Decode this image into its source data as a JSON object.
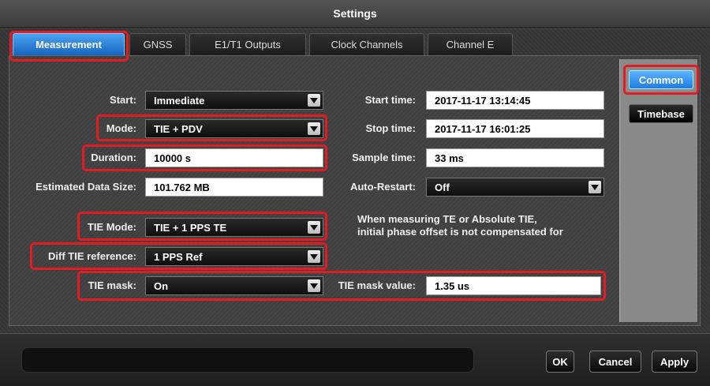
{
  "window": {
    "title": "Settings"
  },
  "tabs": [
    "Measurement",
    "GNSS",
    "E1/T1 Outputs",
    "Clock Channels",
    "Channel E"
  ],
  "sidebar": {
    "common": "Common",
    "timebase": "Timebase"
  },
  "form": {
    "start": {
      "label": "Start:",
      "value": "Immediate"
    },
    "mode": {
      "label": "Mode:",
      "value": "TIE + PDV"
    },
    "duration": {
      "label": "Duration:",
      "value": "10000 s"
    },
    "data_size": {
      "label": "Estimated Data Size:",
      "value": "101.762 MB"
    },
    "tie_mode": {
      "label": "TIE Mode:",
      "value": "TIE + 1 PPS TE"
    },
    "diff_ref": {
      "label": "Diff TIE reference:",
      "value": "1 PPS Ref"
    },
    "tie_mask": {
      "label": "TIE mask:",
      "value": "On"
    },
    "start_time": {
      "label": "Start time:",
      "value": "2017-11-17 13:14:45"
    },
    "stop_time": {
      "label": "Stop time:",
      "value": "2017-11-17 16:01:25"
    },
    "sample_time": {
      "label": "Sample time:",
      "value": "33 ms"
    },
    "auto_restart": {
      "label": "Auto-Restart:",
      "value": "Off"
    },
    "tie_mask_value": {
      "label": "TIE mask value:",
      "value": "1.35 us"
    },
    "note_line1": "When measuring TE or Absolute TIE,",
    "note_line2": "initial phase offset is not compensated for"
  },
  "buttons": {
    "ok": "OK",
    "cancel": "Cancel",
    "apply": "Apply"
  },
  "colors": {
    "highlight": "#e31c23",
    "active_tab": "#1e7de0"
  }
}
